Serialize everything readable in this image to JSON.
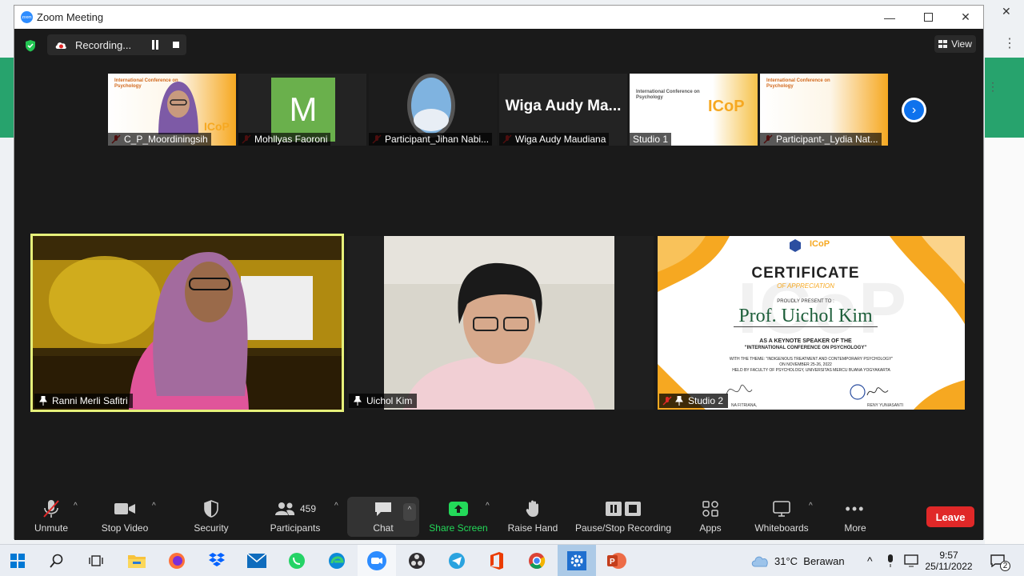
{
  "window": {
    "title": "Zoom Meeting",
    "logo_text": "zoom"
  },
  "recording": {
    "label": "Recording..."
  },
  "view_button": {
    "label": "View"
  },
  "thumbnails": [
    {
      "name": "C_P_Moordiningsih",
      "muted": true
    },
    {
      "name": "Mohllyas Faoroni",
      "muted": true,
      "avatar_letter": "M",
      "avatar_color": "#6ab04c"
    },
    {
      "name": "Participant_Jihan Nabi...",
      "muted": true
    },
    {
      "name": "Wiga Audy Maudiana",
      "muted": true,
      "display_text": "Wiga Audy Ma..."
    },
    {
      "name": "Studio 1",
      "muted": false
    },
    {
      "name": "Participant-_Lydia Nat...",
      "muted": true
    }
  ],
  "conference": {
    "title": "International Conference on Psychology",
    "logo": "ICoP"
  },
  "main_tiles": [
    {
      "name": "Ranni Merli Safitri",
      "active_speaker": true
    },
    {
      "name": "Uichol Kim"
    },
    {
      "name": "Studio 2",
      "muted": true
    }
  ],
  "certificate": {
    "title": "CERTIFICATE",
    "subtitle": "OF APPRECIATION",
    "proudly": "PROUDLY PRESENT TO :",
    "recipient": "Prof. Uichol Kim",
    "role": "AS A KEYNOTE SPEAKER OF THE",
    "event": "\"INTERNATIONAL CONFERENCE ON PSYCHOLOGY\"",
    "theme": "WITH THE THEME: \"INDIGENOUS TREATMENT AND CONTEMPORARY PSYCHOLOGY\"",
    "date": "ON NOVEMBER 25-26, 2022",
    "held_by": "HELD BY FACULTY OF PSYCHOLOGY, UNIVERSITAS MERCU BUANA YOGYAKARTA",
    "signer_left": "NA FITRIANA,",
    "signer_right": "RENY YUNIASANTI",
    "watermark": "ICoP"
  },
  "toolbar": {
    "unmute": "Unmute",
    "stop_video": "Stop Video",
    "security": "Security",
    "participants": "Participants",
    "participants_count": "459",
    "chat": "Chat",
    "share_screen": "Share Screen",
    "raise_hand": "Raise Hand",
    "pause_stop_recording": "Pause/Stop Recording",
    "apps": "Apps",
    "whiteboards": "Whiteboards",
    "more": "More",
    "leave": "Leave"
  },
  "colors": {
    "share_green": "#23d959",
    "leave_red": "#e02828",
    "active_border": "#e6f07a",
    "accent_blue": "#0e72ed"
  },
  "taskbar": {
    "apps": [
      "windows-start",
      "search",
      "task-view",
      "file-explorer",
      "firefox",
      "dropbox",
      "mail",
      "whatsapp",
      "edge",
      "zoom",
      "obs",
      "telegram",
      "office",
      "chrome",
      "settings",
      "powerpoint"
    ],
    "weather": "31°C  Berawan",
    "time": "9:57",
    "date": "25/11/2022",
    "notifications": "2"
  }
}
